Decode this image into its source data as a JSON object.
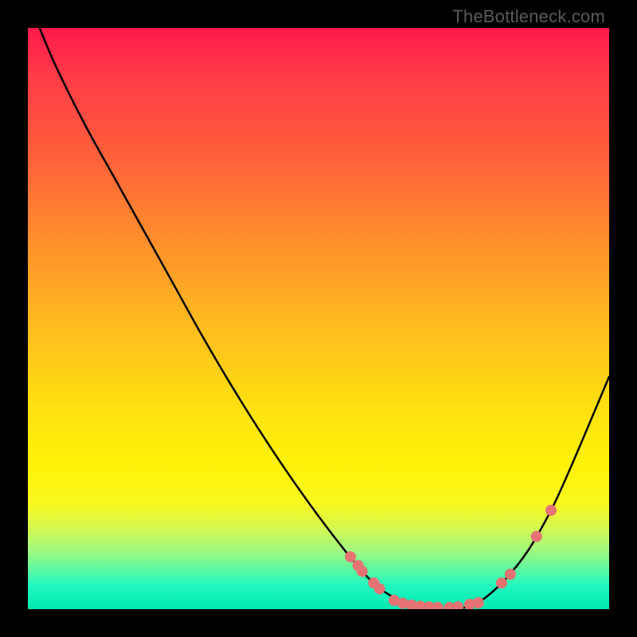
{
  "watermark": "TheBottleneck.com",
  "colors": {
    "background": "#000000",
    "curve": "#000000",
    "dot": "#e57373",
    "gradient_top": "#ff1a4a",
    "gradient_bottom": "#00e8b0"
  },
  "chart_data": {
    "type": "line",
    "title": "",
    "xlabel": "",
    "ylabel": "",
    "xlim": [
      0,
      100
    ],
    "ylim": [
      0,
      100
    ],
    "description": "Bottleneck-style V-curve over rainbow heat gradient; low y = good fit (green), high y = bottleneck (red). Pink dots mark sampled hardware near the minimum and on the right rising branch.",
    "series": [
      {
        "name": "bottleneck-curve",
        "x": [
          2,
          5,
          10,
          15,
          20,
          25,
          30,
          35,
          40,
          45,
          50,
          55,
          58,
          60,
          63,
          66,
          70,
          74,
          78,
          82,
          86,
          90,
          93,
          96,
          100
        ],
        "y": [
          100,
          93,
          83,
          74,
          65,
          56,
          47,
          38.5,
          30.5,
          23,
          16,
          9.5,
          6,
          4,
          2,
          1,
          0,
          0,
          1.5,
          5,
          10,
          17,
          23.5,
          30.5,
          40
        ]
      }
    ],
    "dots": [
      {
        "x": 55.5,
        "y": 9
      },
      {
        "x": 56.8,
        "y": 7.5
      },
      {
        "x": 57.5,
        "y": 6.5
      },
      {
        "x": 59.5,
        "y": 4.5
      },
      {
        "x": 60.5,
        "y": 3.5
      },
      {
        "x": 63,
        "y": 1.5
      },
      {
        "x": 64.5,
        "y": 1
      },
      {
        "x": 66,
        "y": 0.7
      },
      {
        "x": 67.5,
        "y": 0.5
      },
      {
        "x": 69,
        "y": 0.4
      },
      {
        "x": 70.5,
        "y": 0.3
      },
      {
        "x": 72.5,
        "y": 0.3
      },
      {
        "x": 74,
        "y": 0.4
      },
      {
        "x": 76,
        "y": 0.8
      },
      {
        "x": 77.5,
        "y": 1.1
      },
      {
        "x": 81.5,
        "y": 4.5
      },
      {
        "x": 83,
        "y": 6
      },
      {
        "x": 87.5,
        "y": 12.5
      },
      {
        "x": 90,
        "y": 17
      }
    ]
  }
}
